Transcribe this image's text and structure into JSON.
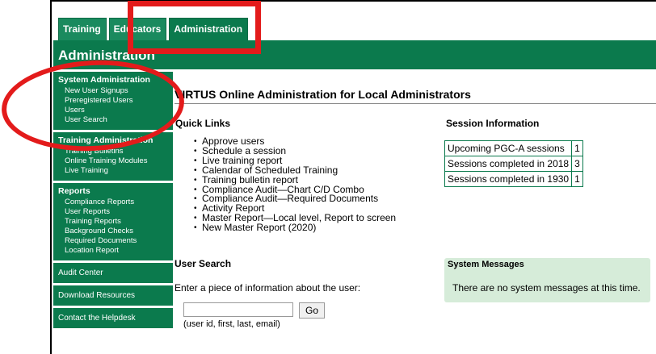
{
  "tabs": [
    {
      "label": "Training"
    },
    {
      "label": "Educators"
    },
    {
      "label": "Administration"
    }
  ],
  "page_heading": "Administration",
  "sidebar": {
    "system_admin": {
      "heading": "System Administration",
      "items": [
        "New User Signups",
        "Preregistered Users",
        "Users",
        "User Search"
      ]
    },
    "training_admin": {
      "heading": "Training Administration",
      "items": [
        "Training Bulletins",
        "Online Training Modules",
        "Live Training"
      ]
    },
    "reports": {
      "heading": "Reports",
      "items": [
        "Compliance Reports",
        "User Reports",
        "Training Reports",
        "Background Checks",
        "Required Documents",
        "Location Report"
      ]
    },
    "audit_center": "Audit Center",
    "download_resources": "Download Resources",
    "contact_helpdesk": "Contact the Helpdesk"
  },
  "main": {
    "title": "VIRTUS Online Administration for Local Administrators",
    "quick_links": {
      "heading": "Quick Links",
      "items": [
        "Approve users",
        "Schedule a session",
        "Live training report",
        "Calendar of Scheduled Training",
        "Training bulletin report",
        "Compliance Audit—Chart C/D Combo",
        "Compliance Audit—Required Documents",
        "Activity Report",
        "Master Report—Local level, Report to screen",
        "New Master Report (2020)"
      ]
    },
    "session_info": {
      "heading": "Session Information",
      "rows": [
        {
          "label": "Upcoming PGC-A sessions",
          "value": "1"
        },
        {
          "label": "Sessions completed in 2018",
          "value": "3"
        },
        {
          "label": "Sessions completed in 1930",
          "value": "1"
        }
      ]
    },
    "user_search": {
      "heading": "User Search",
      "prompt": "Enter a piece of information about the user:",
      "input_value": "",
      "go_label": "Go",
      "hint": "(user id, first, last, email)"
    },
    "system_messages": {
      "heading": "System Messages",
      "text": "There are no system messages at this time."
    }
  },
  "colors": {
    "brand_green": "#0b7a4d",
    "message_box": "#d6ecd9",
    "annotation_red": "#e31b1b"
  }
}
